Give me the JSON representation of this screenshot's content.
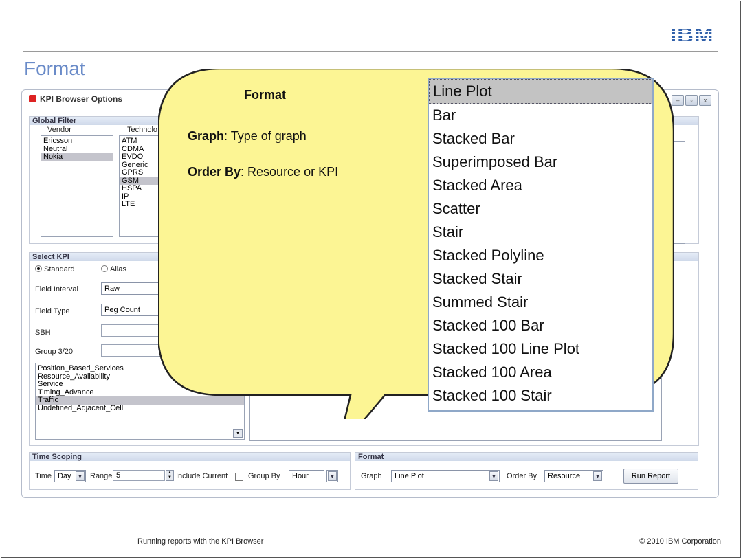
{
  "slide": {
    "brand": "IBM",
    "title": "Format",
    "footer_left": "Running reports with the KPI Browser",
    "footer_right": "© 2010 IBM Corporation"
  },
  "window": {
    "title": "KPI Browser Options",
    "buttons": [
      "–",
      "▫",
      "x"
    ]
  },
  "global_filter": {
    "header": "Global Filter",
    "vendor_label": "Vendor",
    "technology_label": "Technolo",
    "vendors": [
      "Ericsson",
      "Neutral",
      "Nokia"
    ],
    "selected_vendor": "Nokia",
    "technologies": [
      "ATM",
      "CDMA",
      "EVDO",
      "Generic",
      "GPRS",
      "GSM",
      "HSPA",
      "IP",
      "LTE"
    ],
    "selected_technology": "GSM"
  },
  "select_kpi": {
    "header": "Select KPI",
    "radio_standard": "Standard",
    "radio_alias": "Alias",
    "field_interval_label": "Field Interval",
    "field_interval_value": "Raw",
    "field_type_label": "Field Type",
    "field_type_value": "Peg Count",
    "sbh_label": "SBH",
    "group_label": "Group 3/20",
    "groups": [
      "Position_Based_Services",
      "Resource_Availability",
      "Service",
      "Timing_Advance",
      "Traffic",
      "Undefined_Adjacent_Cell"
    ],
    "selected_group": "Traffic"
  },
  "time_scoping": {
    "header": "Time Scoping",
    "time_label": "Time",
    "time_value": "Day",
    "range_label": "Range",
    "range_value": "5",
    "include_current_label": "Include Current",
    "group_by_label": "Group By",
    "group_by_value": "Hour"
  },
  "format_panel": {
    "header": "Format",
    "graph_label": "Graph",
    "graph_value": "Line Plot",
    "order_by_label": "Order By",
    "order_by_value": "Resource",
    "run_report_label": "Run Report"
  },
  "callout": {
    "title": "Format",
    "graph_term": "Graph",
    "graph_desc": ": Type of graph",
    "order_term": "Order By",
    "order_desc": ": Resource or KPI",
    "fill_color": "#fcf594"
  },
  "graph_options": {
    "items": [
      "Line Plot",
      "Bar",
      "Stacked Bar",
      "Superimposed Bar",
      "Stacked Area",
      "Scatter",
      "Stair",
      "Stacked Polyline",
      "Stacked Stair",
      "Summed Stair",
      "Stacked 100 Bar",
      "Stacked 100 Line Plot",
      "Stacked 100 Area",
      "Stacked 100 Stair"
    ],
    "highlighted": "Line Plot"
  }
}
